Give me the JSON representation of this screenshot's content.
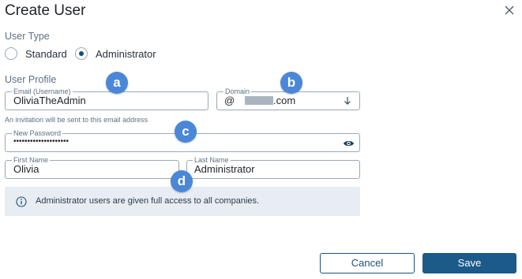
{
  "dialog": {
    "title": "Create User"
  },
  "user_type": {
    "label": "User Type",
    "options": [
      {
        "label": "Standard",
        "selected": false
      },
      {
        "label": "Administrator",
        "selected": true
      }
    ]
  },
  "user_profile": {
    "label": "User Profile",
    "email": {
      "label": "Email (Username)",
      "value": "OliviaTheAdmin",
      "helper": "An invitation will be sent to this email address"
    },
    "domain": {
      "label": "Domain",
      "prefix": "@",
      "suffix": ".com"
    },
    "password": {
      "label": "New Password",
      "value": "••••••••••••••••••••"
    },
    "first_name": {
      "label": "First Name",
      "value": "Olivia"
    },
    "last_name": {
      "label": "Last Name",
      "value": "Administrator"
    }
  },
  "info": {
    "text": "Administrator users are given full access to all companies."
  },
  "callouts": [
    "a",
    "b",
    "c",
    "d"
  ],
  "buttons": {
    "cancel": "Cancel",
    "save": "Save"
  },
  "colors": {
    "primary": "#1c5a8a",
    "callout": "#4a87d8",
    "info_bg": "#e7edf3",
    "border": "#9aa9b8"
  },
  "icons": {
    "close": "close-icon",
    "dropdown": "arrow-down-icon",
    "show_password": "eye-icon",
    "info": "info-icon"
  }
}
